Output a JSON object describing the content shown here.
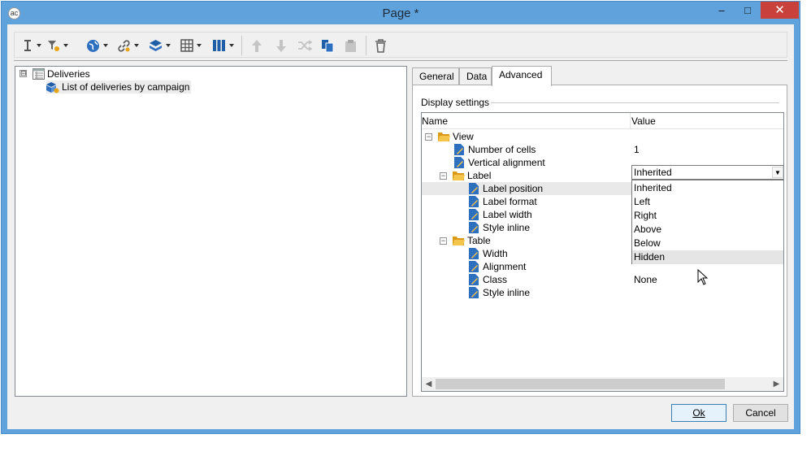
{
  "window": {
    "title": "Page *",
    "app_icon": "adobe-campaign-icon",
    "minimize_glyph": "–",
    "maximize_glyph": "□",
    "close_glyph": "✕"
  },
  "toolbar": {
    "items": [
      "insert-field-icon",
      "insert-filter-icon",
      "web-icon",
      "link-icon",
      "layers-icon",
      "table-icon",
      "columns-icon",
      "move-up-icon",
      "move-down-icon",
      "shuffle-icon",
      "copy-icon",
      "paste-icon",
      "delete-icon"
    ]
  },
  "tree": {
    "root": {
      "label": "Deliveries",
      "expander": "⊟"
    },
    "child": {
      "label": "List of deliveries by campaign"
    }
  },
  "tabs": [
    {
      "label": "General"
    },
    {
      "label": "Data"
    },
    {
      "label": "Advanced"
    }
  ],
  "display_settings": {
    "title": "Display settings",
    "columns": {
      "name": "Name",
      "value": "Value"
    },
    "rows": [
      {
        "name": "View",
        "value": ""
      },
      {
        "name": "Number of cells",
        "value": "1"
      },
      {
        "name": "Vertical alignment",
        "value": ""
      },
      {
        "name": "Label",
        "value": ""
      },
      {
        "name": "Label position",
        "value": "Inherited"
      },
      {
        "name": "Label format",
        "value": ""
      },
      {
        "name": "Label width",
        "value": ""
      },
      {
        "name": "Style inline",
        "value": ""
      },
      {
        "name": "Table",
        "value": ""
      },
      {
        "name": "Width",
        "value": ""
      },
      {
        "name": "Alignment",
        "value": ""
      },
      {
        "name": "Class",
        "value": "None"
      },
      {
        "name": "Style inline",
        "value": ""
      }
    ],
    "dropdown_options": [
      "Inherited",
      "Left",
      "Right",
      "Above",
      "Below",
      "Hidden"
    ],
    "hovered_option": "Hidden"
  },
  "buttons": {
    "ok": "Ok",
    "cancel": "Cancel"
  },
  "colors": {
    "title_bar": "#5fa2dc",
    "close_button": "#c8413a",
    "folder": "#f0b429",
    "doc": "#2e6fbf"
  }
}
